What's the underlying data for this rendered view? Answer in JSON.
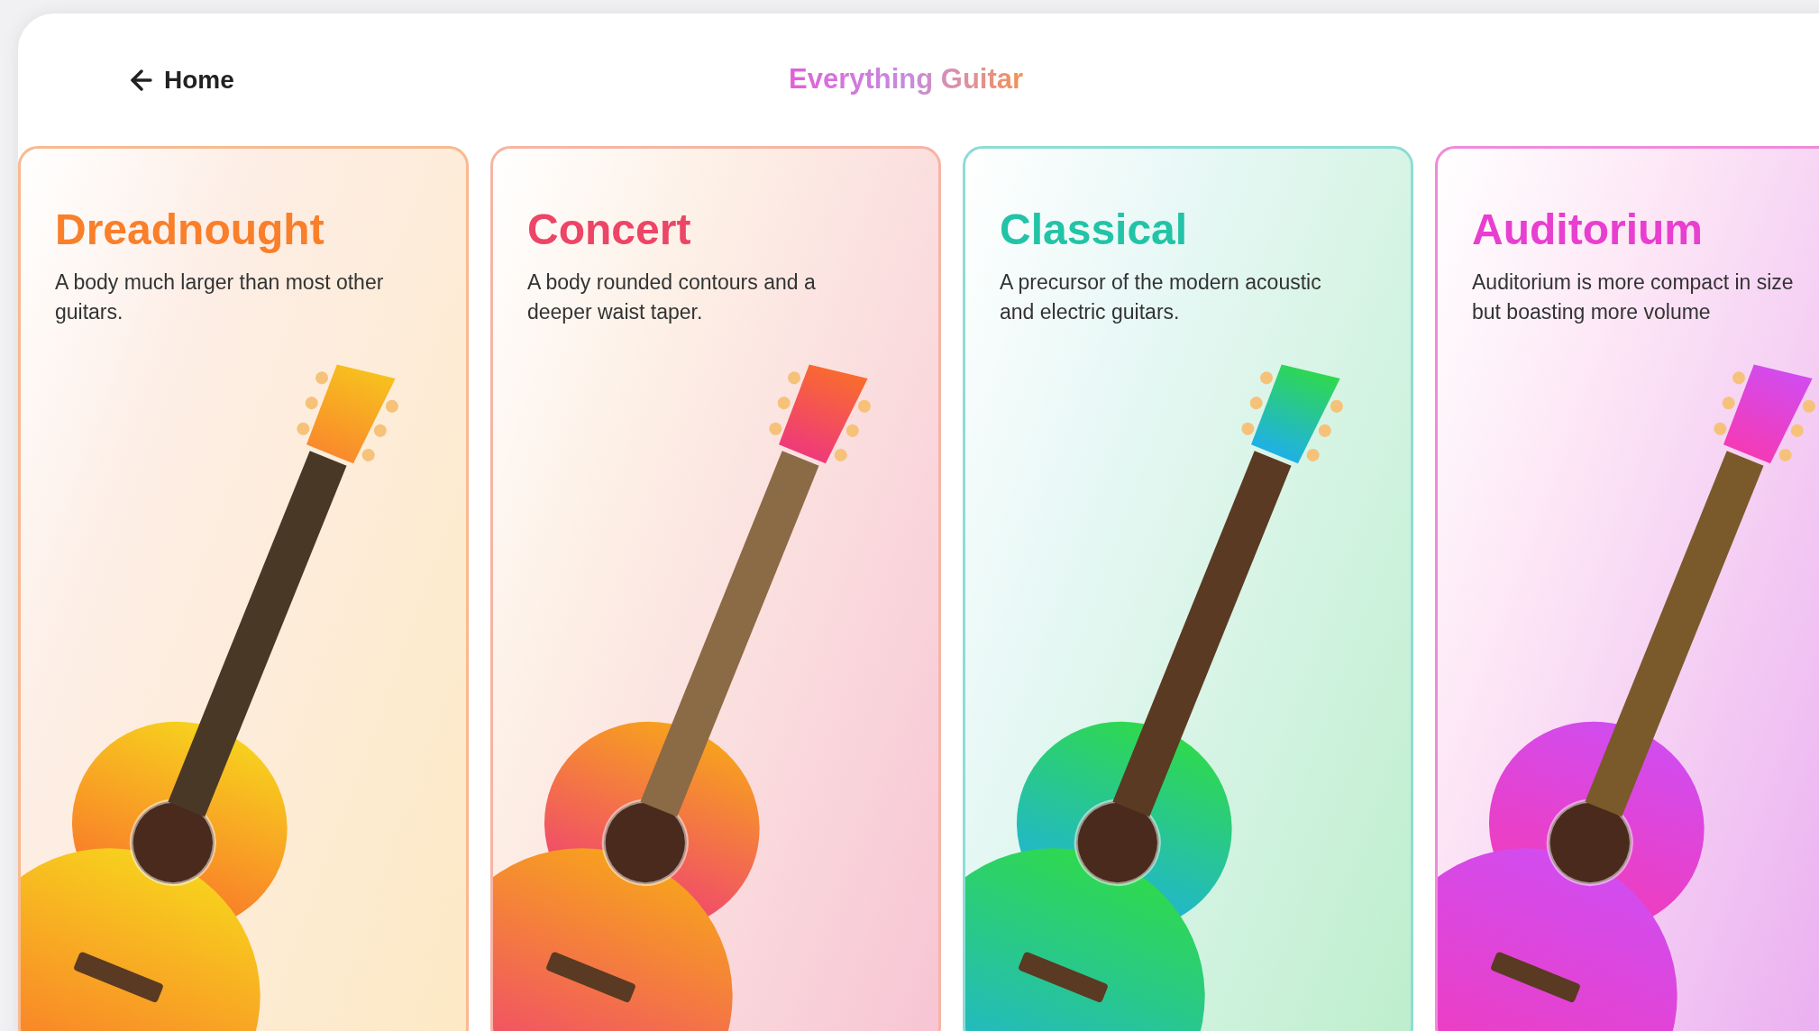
{
  "header": {
    "back_label": "Home",
    "title": "Everything Guitar"
  },
  "cards": [
    {
      "title": "Dreadnought",
      "description": "A body much larger than most other guitars.",
      "color": "#f97f2a"
    },
    {
      "title": "Concert",
      "description": "A body rounded contours and a deeper waist taper.",
      "color": "#ec4566"
    },
    {
      "title": "Classical",
      "description": "A precursor of the modern acoustic and electric guitars.",
      "color": "#22c3a6"
    },
    {
      "title": "Auditorium",
      "description": "Auditorium is more compact in size but boasting more volume",
      "color": "#e83fd0"
    }
  ]
}
